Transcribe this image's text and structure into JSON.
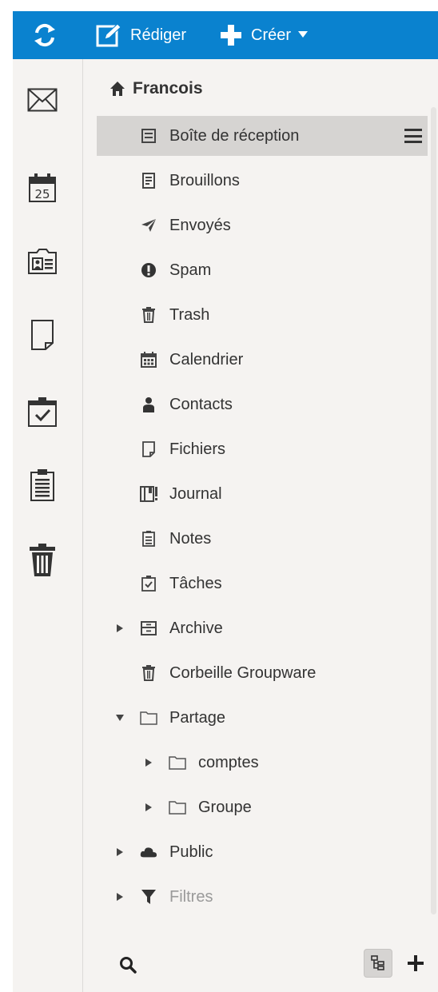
{
  "toolbar": {
    "refresh_icon": "refresh-icon",
    "compose_label": "Rédiger",
    "create_label": "Créer",
    "accent_color": "#0a82cf"
  },
  "rail": {
    "items": [
      {
        "name": "mail",
        "icon": "envelope-icon"
      },
      {
        "name": "calendar",
        "icon": "calendar-icon",
        "day": "25"
      },
      {
        "name": "contacts",
        "icon": "contact-card-icon"
      },
      {
        "name": "files",
        "icon": "file-icon"
      },
      {
        "name": "tasks",
        "icon": "task-check-icon"
      },
      {
        "name": "notes",
        "icon": "clipboard-notes-icon"
      },
      {
        "name": "trash",
        "icon": "trash-icon"
      }
    ]
  },
  "account": {
    "name": "Francois",
    "icon": "home-icon"
  },
  "folders": [
    {
      "label": "Boîte de réception",
      "icon": "inbox-icon",
      "selected": true
    },
    {
      "label": "Brouillons",
      "icon": "drafts-icon"
    },
    {
      "label": "Envoyés",
      "icon": "paper-plane-icon"
    },
    {
      "label": "Spam",
      "icon": "exclamation-icon"
    },
    {
      "label": "Trash",
      "icon": "trash-icon"
    },
    {
      "label": "Calendrier",
      "icon": "calendar-icon"
    },
    {
      "label": "Contacts",
      "icon": "person-icon"
    },
    {
      "label": "Fichiers",
      "icon": "file-icon"
    },
    {
      "label": "Journal",
      "icon": "journal-icon"
    },
    {
      "label": "Notes",
      "icon": "note-icon"
    },
    {
      "label": "Tâches",
      "icon": "task-icon"
    },
    {
      "label": "Archive",
      "icon": "archive-icon",
      "expander": "collapsed"
    },
    {
      "label": "Corbeille Groupware",
      "icon": "trash-icon"
    },
    {
      "label": "Partage",
      "icon": "folder-icon",
      "expander": "expanded"
    },
    {
      "label": "comptes",
      "icon": "folder-icon",
      "expander": "collapsed",
      "level": 1
    },
    {
      "label": "Groupe",
      "icon": "folder-icon",
      "expander": "collapsed",
      "level": 1
    },
    {
      "label": "Public",
      "icon": "cloud-icon",
      "expander": "collapsed"
    },
    {
      "label": "Filtres",
      "icon": "filter-icon",
      "expander": "collapsed",
      "muted": true
    }
  ],
  "bottom": {
    "search_icon": "search-icon",
    "tree_icon": "folder-tree-icon",
    "add_icon": "plus-icon"
  }
}
